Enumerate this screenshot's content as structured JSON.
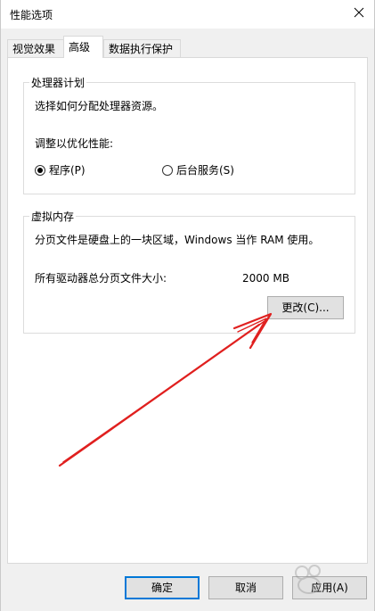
{
  "window": {
    "title": "性能选项",
    "close_glyph": "✕"
  },
  "tabs": [
    {
      "label": "视觉效果",
      "active": false
    },
    {
      "label": "高级",
      "active": true
    },
    {
      "label": "数据执行保护",
      "active": false
    }
  ],
  "processor": {
    "group_title": "处理器计划",
    "description": "选择如何分配处理器资源。",
    "adjust_label": "调整以优化性能:",
    "option_programs": "程序(P)",
    "option_services": "后台服务(S)",
    "selected": "programs"
  },
  "virtual_memory": {
    "group_title": "虚拟内存",
    "description": "分页文件是硬盘上的一块区域，Windows 当作 RAM 使用。",
    "total_label": "所有驱动器总分页文件大小:",
    "total_value": "2000 MB",
    "change_button": "更改(C)..."
  },
  "footer": {
    "ok_button": "确定",
    "cancel_button": "取消",
    "apply_button": "应用(A)"
  },
  "annotation": {
    "arrow_color": "#e0201f"
  }
}
